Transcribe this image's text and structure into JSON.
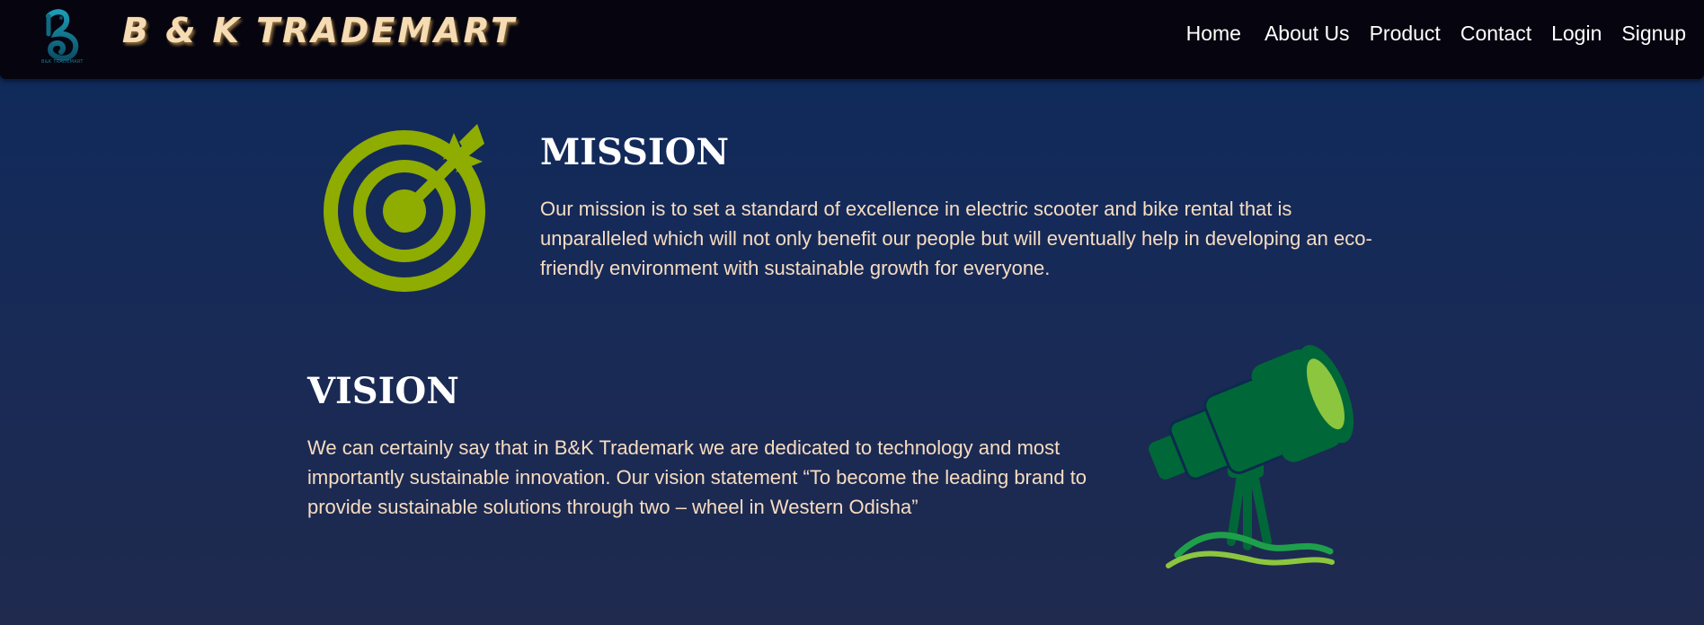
{
  "header": {
    "brand": "B & K TRADEMART",
    "logo_caption": "B&K TRADEMART",
    "nav": [
      {
        "label": "Home"
      },
      {
        "label": "About Us"
      },
      {
        "label": "Product"
      },
      {
        "label": "Contact"
      },
      {
        "label": "Login"
      },
      {
        "label": "Signup"
      }
    ]
  },
  "mission": {
    "icon": "target-arrow-icon",
    "title": "MISSION",
    "text": "Our mission is to set a standard of excellence in electric scooter and bike rental that is unparalleled which will not only benefit our people but will eventually help in developing an eco-friendly environment with sustainable growth for everyone."
  },
  "vision": {
    "icon": "telescope-icon",
    "title": "VISION",
    "text": "We can certainly say that in B&K Trademark we are dedicated to technology and most importantly sustainable innovation. Our vision statement “To become the leading brand to provide sustainable solutions through two – wheel in Western Odisha”"
  },
  "colors": {
    "navbar_bg": "#05040f",
    "page_bg_top": "#0d2a5c",
    "page_bg_bottom": "#1f2a4e",
    "brand_text": "#f6dcb4",
    "body_text": "#f7dcc0",
    "target_green": "#8fac00",
    "telescope_green": "#006838",
    "telescope_lens": "#8cc63f"
  }
}
